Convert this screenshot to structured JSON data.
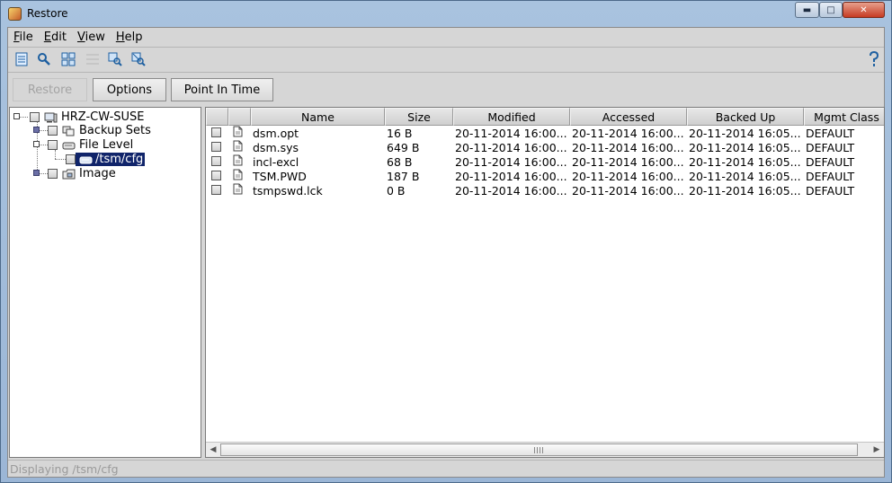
{
  "window": {
    "title": "Restore"
  },
  "menu": [
    {
      "accel": "F",
      "rest": "ile"
    },
    {
      "accel": "E",
      "rest": "dit"
    },
    {
      "accel": "V",
      "rest": "iew"
    },
    {
      "accel": "H",
      "rest": "elp"
    }
  ],
  "toolbar_icons": [
    "details-icon",
    "find-icon",
    "select-all-icon",
    "deselect-icon",
    "filter-icon",
    "clear-filter-icon",
    "context-help-icon"
  ],
  "buttons": {
    "restore": "Restore",
    "options": "Options",
    "point_in_time": "Point In Time"
  },
  "tree": {
    "root": "HRZ-CW-SUSE",
    "backup_sets": "Backup Sets",
    "file_level": "File Level",
    "selected": "/tsm/cfg",
    "image": "Image"
  },
  "table": {
    "columns": [
      "Name",
      "Size",
      "Modified",
      "Accessed",
      "Backed Up",
      "Mgmt Class"
    ],
    "rows": [
      {
        "name": "dsm.opt",
        "size": "16  B",
        "modified": "20-11-2014 16:00...",
        "accessed": "20-11-2014 16:00...",
        "backed_up": "20-11-2014 16:05...",
        "mgmt": "DEFAULT"
      },
      {
        "name": "dsm.sys",
        "size": "649  B",
        "modified": "20-11-2014 16:00...",
        "accessed": "20-11-2014 16:00...",
        "backed_up": "20-11-2014 16:05...",
        "mgmt": "DEFAULT"
      },
      {
        "name": "incl-excl",
        "size": "68  B",
        "modified": "20-11-2014 16:00...",
        "accessed": "20-11-2014 16:00...",
        "backed_up": "20-11-2014 16:05...",
        "mgmt": "DEFAULT"
      },
      {
        "name": "TSM.PWD",
        "size": "187  B",
        "modified": "20-11-2014 16:00...",
        "accessed": "20-11-2014 16:00...",
        "backed_up": "20-11-2014 16:05...",
        "mgmt": "DEFAULT"
      },
      {
        "name": "tsmpswd.lck",
        "size": "0  B",
        "modified": "20-11-2014 16:00...",
        "accessed": "20-11-2014 16:00...",
        "backed_up": "20-11-2014 16:05...",
        "mgmt": "DEFAULT"
      }
    ]
  },
  "status": "Displaying /tsm/cfg"
}
